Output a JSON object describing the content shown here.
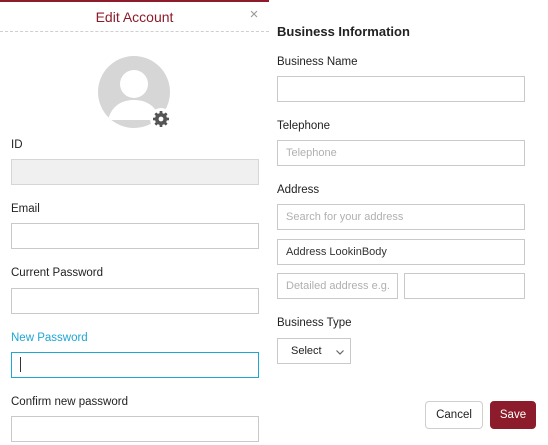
{
  "left": {
    "title": "Edit Account",
    "close_glyph": "×",
    "avatar_icon": "user-avatar-icon",
    "gear_icon": "gear-icon",
    "fields": {
      "id_label": "ID",
      "id_value": "",
      "email_label": "Email",
      "email_value": "",
      "current_password_label": "Current Password",
      "current_password_value": "",
      "new_password_label": "New Password",
      "new_password_value": "",
      "confirm_password_label": "Confirm new password",
      "confirm_password_value": ""
    }
  },
  "right": {
    "section_title": "Business Information",
    "business_name_label": "Business Name",
    "business_name_value": "",
    "telephone_label": "Telephone",
    "telephone_placeholder": "Telephone",
    "address_label": "Address",
    "address_search_placeholder": "Search for your address",
    "address_lookup_value": "Address LookinBody",
    "address_detail_placeholder": "Detailed address e.g.)",
    "address_extra_value": "",
    "business_type_label": "Business Type",
    "business_type_selected": "Select"
  },
  "buttons": {
    "cancel": "Cancel",
    "save": "Save"
  },
  "colors": {
    "brand": "#8c1c2b",
    "active_focus": "#1ea7d4"
  }
}
